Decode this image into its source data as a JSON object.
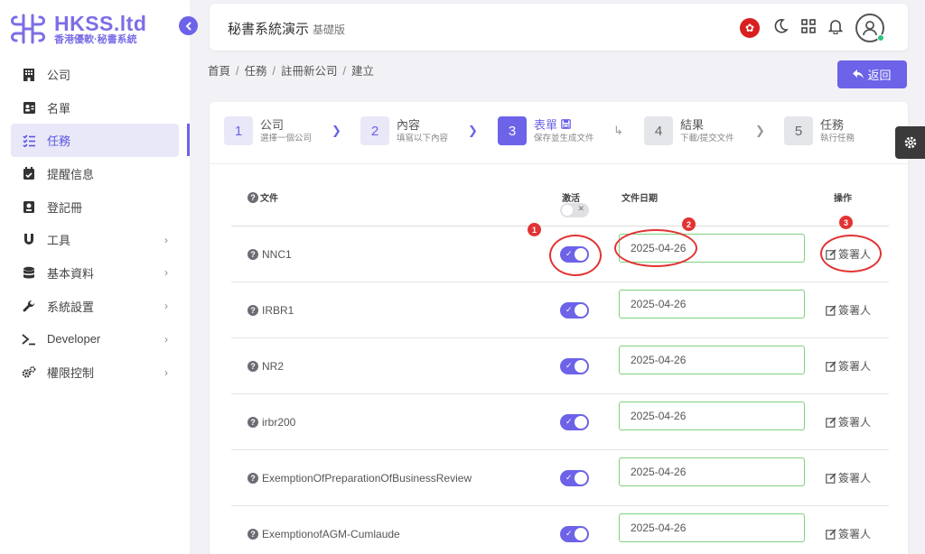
{
  "brand": {
    "title": "HKSS.ltd",
    "subtitle": "香港優軟·秘書系統",
    "color": "#7b6ee6"
  },
  "sidebar": {
    "items": [
      {
        "label": "公司",
        "icon": "building-icon",
        "chevron": false
      },
      {
        "label": "名單",
        "icon": "contact-card-icon",
        "chevron": false
      },
      {
        "label": "任務",
        "icon": "task-list-icon",
        "chevron": false,
        "active": true
      },
      {
        "label": "提醒信息",
        "icon": "calendar-icon",
        "chevron": false
      },
      {
        "label": "登記冊",
        "icon": "register-book-icon",
        "chevron": false
      },
      {
        "label": "工具",
        "icon": "magnet-icon",
        "chevron": true
      },
      {
        "label": "基本資料",
        "icon": "database-icon",
        "chevron": true
      },
      {
        "label": "系統設置",
        "icon": "wrench-icon",
        "chevron": true
      },
      {
        "label": "Developer",
        "icon": "terminal-icon",
        "chevron": true
      },
      {
        "label": "權限控制",
        "icon": "cogs-icon",
        "chevron": true
      }
    ]
  },
  "header": {
    "title": "秘書系統演示",
    "edition": "基礎版",
    "icons": [
      "hk-flag-icon",
      "moon-icon",
      "grid-icon",
      "bell-icon",
      "user-avatar-icon"
    ]
  },
  "breadcrumb": [
    "首頁",
    "任務",
    "註冊新公司",
    "建立"
  ],
  "back_button": {
    "label": "返回"
  },
  "steps": [
    {
      "num": "1",
      "title": "公司",
      "sub": "選擇一個公司"
    },
    {
      "num": "2",
      "title": "內容",
      "sub": "填寫以下內容"
    },
    {
      "num": "3",
      "title": "表單",
      "sub": "保存並生成文件"
    },
    {
      "num": "4",
      "title": "結果",
      "sub": "下載/提交文件"
    },
    {
      "num": "5",
      "title": "任務",
      "sub": "執行任務"
    }
  ],
  "table": {
    "headers": {
      "file": "文件",
      "active": "激活",
      "date": "文件日期",
      "op": "操作"
    },
    "rows": [
      {
        "file": "NNC1",
        "active": true,
        "date": "2025-04-26",
        "action": "簽署人"
      },
      {
        "file": "IRBR1",
        "active": true,
        "date": "2025-04-26",
        "action": "簽署人"
      },
      {
        "file": "NR2",
        "active": true,
        "date": "2025-04-26",
        "action": "簽署人"
      },
      {
        "file": "irbr200",
        "active": true,
        "date": "2025-04-26",
        "action": "簽署人"
      },
      {
        "file": "ExemptionOfPreparationOfBusinessReview",
        "active": true,
        "date": "2025-04-26",
        "action": "簽署人"
      },
      {
        "file": "ExemptionofAGM-Cumlaude",
        "active": true,
        "date": "2025-04-26",
        "action": "簽署人"
      }
    ]
  },
  "annotations": [
    "1",
    "2",
    "3"
  ],
  "colors": {
    "accent": "#6c63e8",
    "annotation": "#e23333",
    "input_border": "#7ed07e"
  }
}
